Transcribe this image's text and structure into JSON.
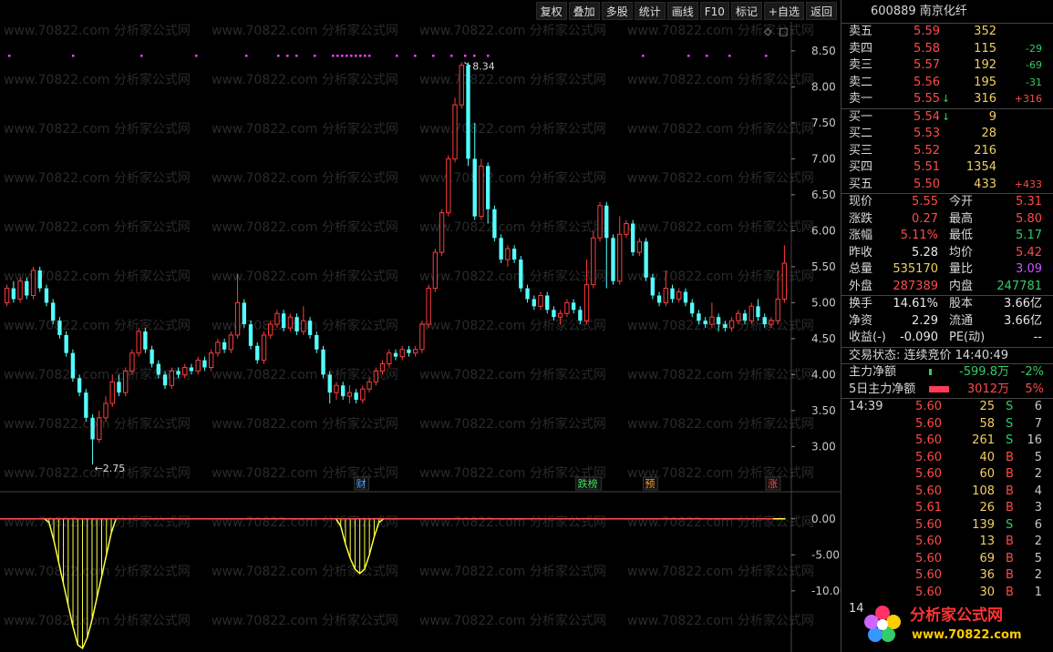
{
  "toolbar": {
    "buttons": [
      "复权",
      "叠加",
      "多股",
      "统计",
      "画线",
      "F10",
      "标记",
      "+自选",
      "返回"
    ]
  },
  "watermark": "www.70822.com 分析家公式网",
  "chart": {
    "high_label": "8.34",
    "low_label": "2.75",
    "price_ticks": [
      "8.50",
      "8.00",
      "7.50",
      "7.00",
      "6.50",
      "6.00",
      "5.50",
      "5.00",
      "4.50",
      "4.00",
      "3.50",
      "3.00"
    ],
    "indicator_ticks": [
      "0.00",
      "-5.00",
      "-10.00"
    ],
    "events": [
      {
        "text": "财",
        "color": "#4aa8ff"
      },
      {
        "text": "跌榜",
        "color": "#44dd66"
      },
      {
        "text": "预",
        "color": "#ff9933"
      },
      {
        "text": "涨",
        "color": "#ff4444"
      }
    ],
    "colors": {
      "up": "#ff3c3c",
      "down": "#54ffff",
      "indicator": "#ffff40",
      "zero_line": "#ff5050",
      "marker": "#ff40ff"
    }
  },
  "chart_data": {
    "type": "candlestick",
    "ylim": [
      2.6,
      8.6
    ],
    "indicator_ylim": [
      -18,
      2
    ],
    "marker_columns": [
      1,
      15,
      30,
      42,
      53,
      60,
      62,
      64,
      68,
      72,
      73,
      74,
      75,
      76,
      77,
      78,
      79,
      80,
      86,
      90,
      94,
      98,
      101,
      103,
      106,
      140,
      150,
      154,
      159,
      167
    ],
    "candles": [
      [
        5.0,
        5.2,
        4.95,
        5.25
      ],
      [
        5.2,
        5.05,
        5.0,
        5.3
      ],
      [
        5.05,
        5.3,
        5.0,
        5.35
      ],
      [
        5.3,
        5.1,
        5.05,
        5.35
      ],
      [
        5.1,
        5.45,
        5.05,
        5.5
      ],
      [
        5.45,
        5.2,
        5.15,
        5.5
      ],
      [
        5.2,
        5.0,
        4.95,
        5.25
      ],
      [
        5.0,
        4.75,
        4.7,
        5.05
      ],
      [
        4.75,
        4.55,
        4.5,
        4.8
      ],
      [
        4.55,
        4.3,
        4.25,
        4.6
      ],
      [
        4.3,
        3.95,
        3.9,
        4.35
      ],
      [
        3.95,
        3.75,
        3.7,
        4.0
      ],
      [
        3.75,
        3.4,
        3.35,
        3.8
      ],
      [
        3.4,
        3.1,
        2.75,
        3.45
      ],
      [
        3.1,
        3.4,
        3.05,
        3.5
      ],
      [
        3.4,
        3.6,
        3.35,
        3.7
      ],
      [
        3.6,
        3.9,
        3.55,
        4.0
      ],
      [
        3.9,
        3.75,
        3.7,
        4.0
      ],
      [
        3.75,
        4.05,
        3.7,
        4.1
      ],
      [
        4.05,
        4.3,
        4.0,
        4.35
      ],
      [
        4.3,
        4.6,
        4.25,
        4.65
      ],
      [
        4.6,
        4.35,
        4.3,
        4.65
      ],
      [
        4.35,
        4.15,
        4.1,
        4.4
      ],
      [
        4.15,
        4.0,
        3.95,
        4.2
      ],
      [
        4.0,
        3.85,
        3.8,
        4.05
      ],
      [
        3.85,
        4.05,
        3.8,
        4.1
      ],
      [
        4.05,
        4.0,
        3.95,
        4.1
      ],
      [
        4.0,
        4.1,
        3.95,
        4.15
      ],
      [
        4.1,
        4.05,
        4.0,
        4.15
      ],
      [
        4.05,
        4.2,
        4.0,
        4.25
      ],
      [
        4.2,
        4.1,
        4.05,
        4.25
      ],
      [
        4.1,
        4.3,
        4.05,
        4.35
      ],
      [
        4.3,
        4.45,
        4.25,
        4.5
      ],
      [
        4.45,
        4.35,
        4.3,
        4.5
      ],
      [
        4.35,
        4.55,
        4.3,
        4.6
      ],
      [
        4.55,
        5.0,
        4.5,
        5.4
      ],
      [
        5.0,
        4.7,
        4.65,
        5.05
      ],
      [
        4.7,
        4.4,
        4.35,
        4.75
      ],
      [
        4.4,
        4.2,
        4.15,
        4.45
      ],
      [
        4.2,
        4.55,
        4.15,
        4.6
      ],
      [
        4.55,
        4.7,
        4.5,
        4.75
      ],
      [
        4.7,
        4.85,
        4.65,
        4.9
      ],
      [
        4.85,
        4.65,
        4.6,
        4.9
      ],
      [
        4.65,
        4.8,
        4.6,
        4.85
      ],
      [
        4.8,
        4.6,
        4.55,
        4.85
      ],
      [
        4.6,
        4.75,
        4.55,
        4.95
      ],
      [
        4.75,
        4.55,
        4.5,
        4.8
      ],
      [
        4.55,
        4.35,
        4.3,
        4.6
      ],
      [
        4.35,
        4.0,
        3.95,
        4.4
      ],
      [
        4.0,
        3.75,
        3.6,
        4.05
      ],
      [
        3.75,
        3.85,
        3.65,
        3.9
      ],
      [
        3.85,
        3.7,
        3.65,
        3.9
      ],
      [
        3.7,
        3.75,
        3.6,
        3.85
      ],
      [
        3.75,
        3.65,
        3.6,
        3.8
      ],
      [
        3.65,
        3.8,
        3.6,
        3.85
      ],
      [
        3.8,
        3.9,
        3.75,
        3.95
      ],
      [
        3.9,
        4.05,
        3.85,
        4.1
      ],
      [
        4.05,
        4.15,
        4.0,
        4.2
      ],
      [
        4.15,
        4.3,
        4.1,
        4.35
      ],
      [
        4.3,
        4.25,
        4.2,
        4.35
      ],
      [
        4.25,
        4.35,
        4.2,
        4.4
      ],
      [
        4.35,
        4.3,
        4.25,
        4.4
      ],
      [
        4.3,
        4.35,
        4.25,
        4.4
      ],
      [
        4.35,
        4.7,
        4.3,
        4.75
      ],
      [
        4.7,
        5.2,
        4.65,
        5.25
      ],
      [
        5.2,
        5.7,
        5.15,
        5.75
      ],
      [
        5.7,
        6.25,
        5.65,
        6.3
      ],
      [
        6.25,
        7.0,
        6.2,
        7.05
      ],
      [
        7.0,
        7.75,
        6.95,
        7.85
      ],
      [
        7.75,
        8.3,
        7.7,
        8.34
      ],
      [
        8.3,
        7.0,
        6.9,
        8.34
      ],
      [
        7.0,
        6.2,
        6.15,
        7.5
      ],
      [
        6.2,
        6.9,
        6.15,
        7.0
      ],
      [
        6.9,
        6.3,
        6.1,
        6.95
      ],
      [
        6.3,
        5.9,
        5.85,
        6.35
      ],
      [
        5.9,
        5.6,
        5.55,
        5.95
      ],
      [
        5.6,
        5.75,
        5.5,
        5.8
      ],
      [
        5.75,
        5.6,
        5.55,
        5.8
      ],
      [
        5.6,
        5.2,
        5.15,
        5.65
      ],
      [
        5.2,
        5.05,
        5.0,
        5.25
      ],
      [
        5.05,
        4.95,
        4.9,
        5.1
      ],
      [
        4.95,
        5.1,
        4.9,
        5.15
      ],
      [
        5.1,
        4.9,
        4.85,
        5.15
      ],
      [
        4.9,
        4.8,
        4.75,
        4.95
      ],
      [
        4.8,
        4.85,
        4.7,
        4.9
      ],
      [
        4.85,
        5.0,
        4.8,
        5.05
      ],
      [
        5.0,
        4.9,
        4.85,
        5.05
      ],
      [
        4.9,
        4.75,
        4.7,
        4.95
      ],
      [
        4.75,
        5.25,
        4.7,
        5.6
      ],
      [
        5.25,
        5.9,
        5.2,
        6.0
      ],
      [
        5.9,
        6.35,
        5.85,
        6.4
      ],
      [
        6.35,
        5.9,
        5.2,
        6.4
      ],
      [
        5.9,
        5.3,
        5.25,
        5.95
      ],
      [
        5.3,
        5.95,
        5.25,
        6.2
      ],
      [
        5.95,
        6.1,
        5.9,
        6.15
      ],
      [
        6.1,
        5.7,
        5.65,
        6.15
      ],
      [
        5.7,
        5.85,
        5.65,
        5.9
      ],
      [
        5.85,
        5.35,
        5.3,
        5.9
      ],
      [
        5.35,
        5.1,
        5.05,
        5.4
      ],
      [
        5.1,
        5.0,
        4.95,
        5.15
      ],
      [
        5.0,
        5.2,
        4.95,
        5.45
      ],
      [
        5.2,
        5.05,
        5.0,
        5.25
      ],
      [
        5.05,
        5.15,
        5.0,
        5.2
      ],
      [
        5.15,
        5.0,
        4.95,
        5.2
      ],
      [
        5.0,
        4.85,
        4.8,
        5.05
      ],
      [
        4.85,
        4.75,
        4.7,
        4.9
      ],
      [
        4.75,
        4.7,
        4.65,
        4.8
      ],
      [
        4.7,
        4.8,
        4.65,
        5.0
      ],
      [
        4.8,
        4.7,
        4.6,
        4.85
      ],
      [
        4.7,
        4.65,
        4.6,
        4.75
      ],
      [
        4.65,
        4.75,
        4.6,
        4.8
      ],
      [
        4.75,
        4.85,
        4.7,
        4.9
      ],
      [
        4.85,
        4.75,
        4.7,
        4.9
      ],
      [
        4.75,
        4.95,
        4.7,
        5.0
      ],
      [
        4.95,
        4.8,
        4.75,
        5.05
      ],
      [
        4.8,
        4.7,
        4.65,
        4.85
      ],
      [
        4.7,
        4.75,
        4.65,
        4.8
      ],
      [
        4.75,
        5.05,
        4.7,
        5.45
      ],
      [
        5.05,
        5.55,
        5.0,
        5.8
      ]
    ],
    "indicator": [
      0,
      0,
      0,
      0,
      0,
      0,
      0,
      0,
      0,
      -0.5,
      -3,
      -6,
      -9,
      -12,
      -15,
      -17.5,
      -18,
      -16.5,
      -14,
      -11,
      -8,
      -5,
      -2,
      0,
      0,
      0,
      0,
      0,
      0,
      0,
      0,
      0,
      0,
      0,
      0,
      0,
      0,
      0,
      0,
      0,
      0,
      0,
      0,
      0,
      0,
      0,
      0,
      0,
      0,
      0,
      0,
      0,
      0,
      0,
      0,
      0,
      0,
      0,
      0,
      0,
      0,
      0,
      0,
      0,
      0,
      0,
      0,
      0,
      0,
      0,
      -1,
      -3.5,
      -5.5,
      -7,
      -7.6,
      -7,
      -5,
      -2.5,
      -0.5,
      0,
      0,
      0,
      0,
      0,
      0,
      0,
      0,
      0,
      0,
      0,
      0,
      0,
      0,
      0,
      0,
      0,
      0,
      0,
      0,
      0,
      0,
      0,
      0,
      0,
      0,
      0,
      0,
      0,
      0,
      0,
      0,
      0,
      0,
      0,
      0,
      0,
      0,
      0,
      0,
      0,
      0,
      0,
      0,
      0,
      0,
      0,
      0,
      0,
      0,
      0,
      0,
      0,
      0,
      0,
      0,
      0,
      0,
      0,
      0,
      0,
      0,
      0,
      0,
      0,
      0,
      0,
      0,
      0,
      0,
      0,
      0,
      0,
      0,
      0,
      0,
      0,
      0,
      0,
      0,
      0,
      0,
      0,
      0,
      0
    ]
  },
  "stock": {
    "code": "600889",
    "name": "南京化纤"
  },
  "orderbook": {
    "asks": [
      {
        "label": "卖五",
        "price": "5.59",
        "vol": "352",
        "chg": ""
      },
      {
        "label": "卖四",
        "price": "5.58",
        "vol": "115",
        "chg": "-29"
      },
      {
        "label": "卖三",
        "price": "5.57",
        "vol": "192",
        "chg": "-69"
      },
      {
        "label": "卖二",
        "price": "5.56",
        "vol": "195",
        "chg": "-31"
      },
      {
        "label": "卖一",
        "price": "5.55",
        "vol": "316",
        "chg": "+316",
        "arrow": "↓"
      }
    ],
    "bids": [
      {
        "label": "买一",
        "price": "5.54",
        "vol": "9",
        "chg": "",
        "arrow": "↓"
      },
      {
        "label": "买二",
        "price": "5.53",
        "vol": "28",
        "chg": ""
      },
      {
        "label": "买三",
        "price": "5.52",
        "vol": "216",
        "chg": ""
      },
      {
        "label": "买四",
        "price": "5.51",
        "vol": "1354",
        "chg": ""
      },
      {
        "label": "买五",
        "price": "5.50",
        "vol": "433",
        "chg": "+433"
      }
    ]
  },
  "quote": [
    {
      "l1": "现价",
      "v1": "5.55",
      "c1": "red",
      "l2": "今开",
      "v2": "5.31",
      "c2": "red"
    },
    {
      "l1": "涨跌",
      "v1": "0.27",
      "c1": "red",
      "l2": "最高",
      "v2": "5.80",
      "c2": "red"
    },
    {
      "l1": "涨幅",
      "v1": "5.11%",
      "c1": "red",
      "l2": "最低",
      "v2": "5.17",
      "c2": "green"
    },
    {
      "l1": "昨收",
      "v1": "5.28",
      "c1": "white",
      "l2": "均价",
      "v2": "5.42",
      "c2": "red"
    },
    {
      "l1": "总量",
      "v1": "535170",
      "c1": "yellow",
      "l2": "量比",
      "v2": "3.09",
      "c2": "purple"
    },
    {
      "l1": "外盘",
      "v1": "287389",
      "c1": "red",
      "l2": "内盘",
      "v2": "247781",
      "c2": "green"
    }
  ],
  "fundamentals": [
    {
      "l1": "换手",
      "v1": "14.61%",
      "l2": "股本",
      "v2": "3.66亿"
    },
    {
      "l1": "净资",
      "v1": "2.29",
      "l2": "流通",
      "v2": "3.66亿"
    },
    {
      "l1": "收益(-)",
      "v1": "-0.090",
      "l2": "PE(动)",
      "v2": "--"
    }
  ],
  "status": "交易状态: 连续竞价 14:40:49",
  "flow": [
    {
      "label": "主力净额",
      "value": "-599.8万",
      "pct": "-2%",
      "color": "green",
      "bar": 0.05
    },
    {
      "label": "5日主力净额",
      "value": "3012万",
      "pct": "5%",
      "color": "red",
      "bar": 0.9
    }
  ],
  "ticks": [
    {
      "time": "14:39",
      "price": "5.60",
      "vol": "25",
      "dir": "S",
      "n": "6"
    },
    {
      "time": "",
      "price": "5.60",
      "vol": "58",
      "dir": "S",
      "n": "7"
    },
    {
      "time": "",
      "price": "5.60",
      "vol": "261",
      "dir": "S",
      "n": "16"
    },
    {
      "time": "",
      "price": "5.60",
      "vol": "40",
      "dir": "B",
      "n": "5"
    },
    {
      "time": "",
      "price": "5.60",
      "vol": "60",
      "dir": "B",
      "n": "2"
    },
    {
      "time": "",
      "price": "5.60",
      "vol": "108",
      "dir": "B",
      "n": "4"
    },
    {
      "time": "",
      "price": "5.61",
      "vol": "26",
      "dir": "B",
      "n": "3"
    },
    {
      "time": "",
      "price": "5.60",
      "vol": "139",
      "dir": "S",
      "n": "6"
    },
    {
      "time": "",
      "price": "5.60",
      "vol": "13",
      "dir": "B",
      "n": "2"
    },
    {
      "time": "",
      "price": "5.60",
      "vol": "69",
      "dir": "B",
      "n": "5"
    },
    {
      "time": "",
      "price": "5.60",
      "vol": "36",
      "dir": "B",
      "n": "2"
    },
    {
      "time": "",
      "price": "5.60",
      "vol": "30",
      "dir": "B",
      "n": "1"
    },
    {
      "time": "14",
      "price": "",
      "vol": "",
      "dir": "",
      "n": ""
    }
  ],
  "logo": {
    "title": "分析家公式网",
    "url": "www.70822.com"
  }
}
